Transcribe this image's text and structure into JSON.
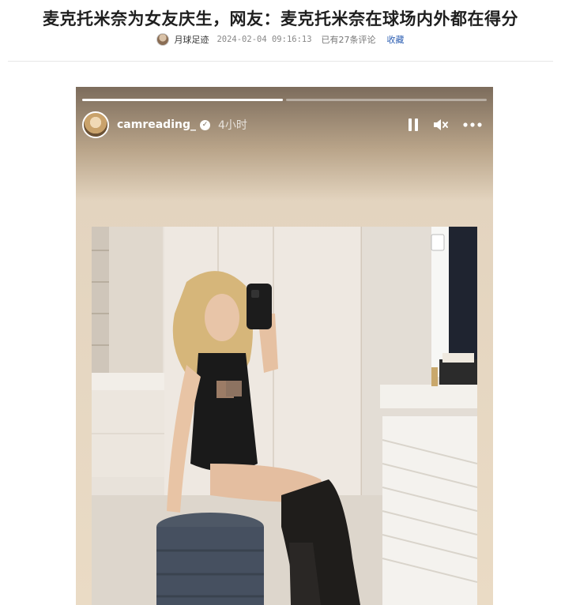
{
  "article": {
    "title": "麦克托米奈为女友庆生，网友：麦克托米奈在球场内外都在得分",
    "author": "月球足迹",
    "datetime": "2024-02-04 09:16:13",
    "comments": "已有27条评论",
    "favorite_label": "收藏"
  },
  "story": {
    "username": "camreading_",
    "time_ago": "4小时",
    "verified_mark": "✓",
    "progress": [
      1.0,
      0.0
    ],
    "icons": [
      "pause-icon",
      "mute-icon",
      "more-icon"
    ]
  },
  "colors": {
    "link": "#2d5fb3",
    "story_bg": "#eadbc5"
  }
}
